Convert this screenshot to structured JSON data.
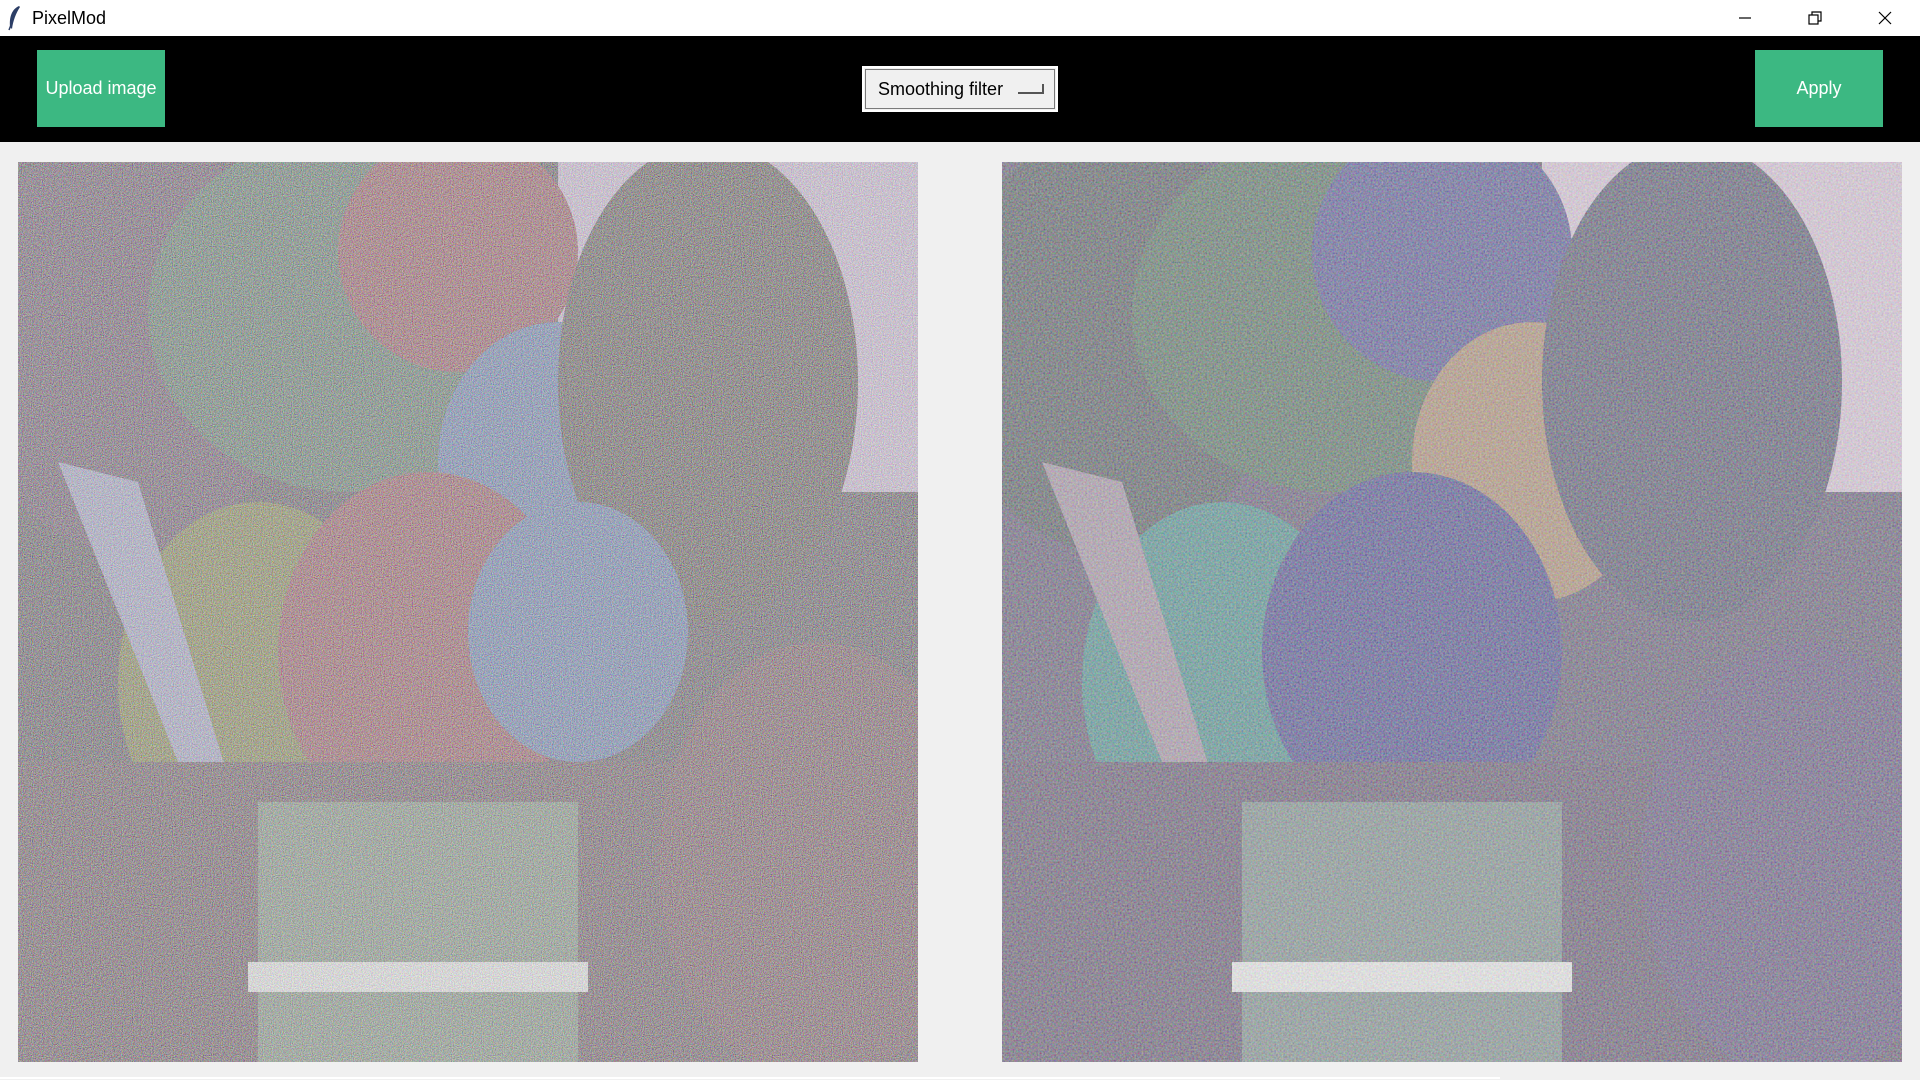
{
  "window": {
    "title": "PixelMod",
    "controls": [
      "minimize-icon",
      "restore-icon",
      "close-icon"
    ]
  },
  "toolbar": {
    "upload_label": "Upload image",
    "filter_selected": "Smoothing filter",
    "apply_label": "Apply"
  },
  "colors": {
    "accent_button": "#3cb882",
    "toolbar_bg": "#000000",
    "workspace_bg": "#f0f0f0"
  },
  "images": {
    "original": {
      "description_icon": "noisy-balloons-image"
    },
    "processed": {
      "description_icon": "smoothed-balloons-image"
    }
  }
}
